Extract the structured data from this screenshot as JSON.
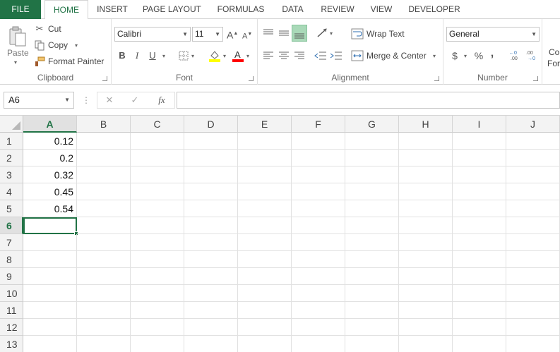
{
  "tabs": [
    "FILE",
    "HOME",
    "INSERT",
    "PAGE LAYOUT",
    "FORMULAS",
    "DATA",
    "REVIEW",
    "VIEW",
    "DEVELOPER"
  ],
  "clipboard": {
    "paste_label": "Paste",
    "cut_label": "Cut",
    "copy_label": "Copy",
    "format_painter_label": "Format Painter",
    "group_label": "Clipboard"
  },
  "font": {
    "name": "Calibri",
    "size": "11",
    "bold": "B",
    "italic": "I",
    "underline": "U",
    "group_label": "Font",
    "highlight_color": "#ffff00",
    "font_color": "#ff0000"
  },
  "alignment": {
    "wrap_text_label": "Wrap Text",
    "merge_center_label": "Merge & Center",
    "group_label": "Alignment"
  },
  "number": {
    "format": "General",
    "currency_symbol": "$",
    "percent_symbol": "%",
    "comma_symbol": ",",
    "group_label": "Number"
  },
  "conditional_formatting": {
    "line1": "Co",
    "line2": "For"
  },
  "formula_bar": {
    "name_box": "A6",
    "fx": "fx",
    "cancel": "✕",
    "enter": "✓",
    "value": ""
  },
  "sheet": {
    "columns": [
      "A",
      "B",
      "C",
      "D",
      "E",
      "F",
      "G",
      "H",
      "I",
      "J"
    ],
    "rows": [
      "1",
      "2",
      "3",
      "4",
      "5",
      "6",
      "7",
      "8",
      "9",
      "10",
      "11",
      "12",
      "13"
    ],
    "column_a_values": [
      "0.12",
      "0.2",
      "0.32",
      "0.45",
      "0.54",
      "",
      "",
      "",
      "",
      "",
      "",
      "",
      ""
    ],
    "active_cell": "A6",
    "accent_color": "#217346"
  }
}
